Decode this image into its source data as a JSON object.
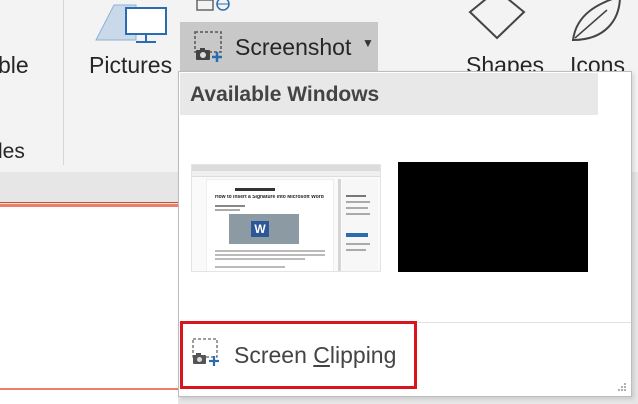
{
  "ribbon": {
    "left_cut_top": "ble",
    "left_cut_bottom": "les",
    "pictures_label": "Pictures",
    "screenshot_label": "Screenshot",
    "shapes_label": "Shapes",
    "icons_label": "Icons"
  },
  "dropdown": {
    "header": "Available Windows",
    "window1": {
      "title": "How to Insert a Signature into Microsoft Word"
    },
    "screen_clipping": {
      "label_before": "Screen ",
      "label_underlined": "C",
      "label_after": "lipping"
    }
  },
  "colors": {
    "highlight_border": "#d9141c",
    "accent": "#2b6cb0",
    "selected_button": "#c8c8c8"
  }
}
